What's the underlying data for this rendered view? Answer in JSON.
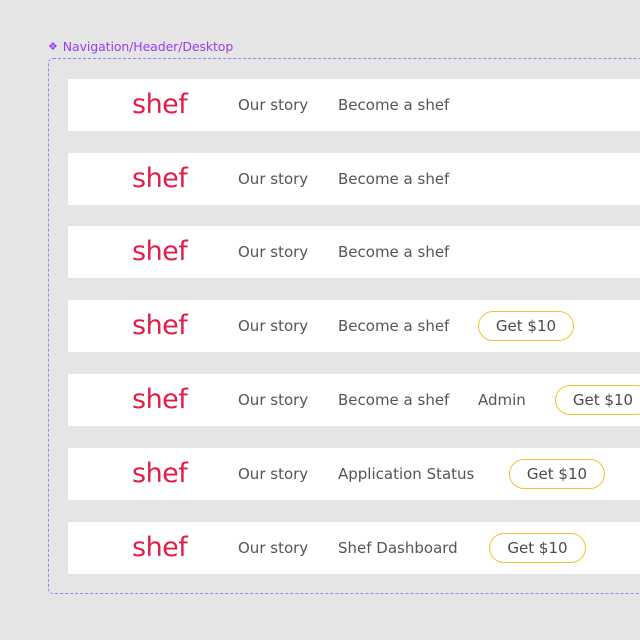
{
  "component_label": "Navigation/Header/Desktop",
  "rows": [
    {
      "logo": "shef",
      "our_story": "Our story",
      "second_link": "Become a shef"
    },
    {
      "logo": "shef",
      "our_story": "Our story",
      "second_link": "Become a shef"
    },
    {
      "logo": "shef",
      "our_story": "Our story",
      "second_link": "Become a shef"
    },
    {
      "logo": "shef",
      "our_story": "Our story",
      "second_link": "Become a shef",
      "cta": "Get $10"
    },
    {
      "logo": "shef",
      "our_story": "Our story",
      "second_link": "Become a shef",
      "admin": "Admin",
      "cta": "Get $10"
    },
    {
      "logo": "shef",
      "our_story": "Our story",
      "second_link": "Application Status",
      "cta": "Get $10"
    },
    {
      "logo": "shef",
      "our_story": "Our story",
      "second_link": "Shef Dashboard",
      "cta": "Get $10"
    }
  ],
  "colors": {
    "brand": "#e01e4a",
    "cta_border": "#f2c230",
    "frame_border": "#a77cf5",
    "label": "#9b3df0"
  }
}
